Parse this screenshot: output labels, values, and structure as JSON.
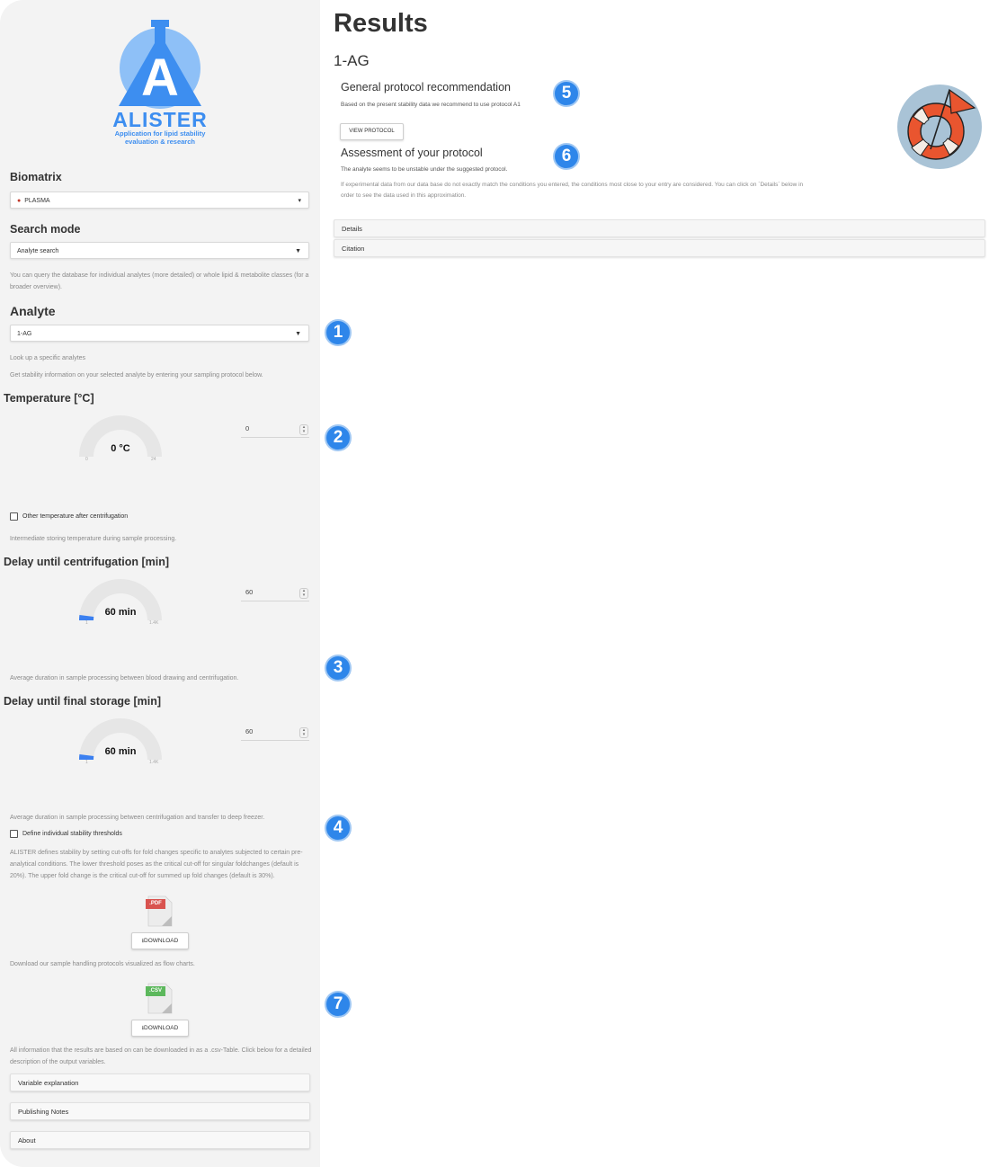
{
  "sidebar": {
    "logo": {
      "word": "ALISTER",
      "subtitle_line1": "Application for lipid stability",
      "subtitle_line2": "evaluation & research"
    },
    "biomatrix": {
      "label": "Biomatrix",
      "value": "PLASMA"
    },
    "search_mode": {
      "label": "Search mode",
      "value": "Analyte search",
      "help": "You can query the database for individual analytes (more detailed) or whole lipid & metabolite classes (for a broader overview)."
    },
    "analyte": {
      "label": "Analyte",
      "value": "1-AG",
      "help1": "Look up a specific analytes",
      "help2": "Get stability information on your selected analyte by entering your sampling protocol below."
    },
    "temperature": {
      "label": "Temperature [°C]",
      "gauge_value": "0 °C",
      "gauge_min": "0",
      "gauge_max": "24",
      "gauge_fraction": 0,
      "input_value": "0",
      "checkbox_label": "Other temperature after centrifugation",
      "help": "Intermediate storing temperature during sample processing."
    },
    "delay_centrifugation": {
      "label": "Delay until centrifugation [min]",
      "gauge_value": "60 min",
      "gauge_min": "1",
      "gauge_max": "1.4K",
      "gauge_fraction": 0.042,
      "input_value": "60",
      "help": "Average duration in sample processing between blood drawing and centrifugation."
    },
    "delay_storage": {
      "label": "Delay until final storage [min]",
      "gauge_value": "60 min",
      "gauge_min": "1",
      "gauge_max": "1.4K",
      "gauge_fraction": 0.042,
      "input_value": "60",
      "help": "Average duration in sample processing between centrifugation and transfer to deep freezer."
    },
    "thresholds": {
      "checkbox_label": "Define individual stability thresholds",
      "help": "ALISTER defines stability by setting cut-offs for fold changes specific to analytes subjected to certain pre-analytical conditions. The lower threshold poses as the critical cut-off for singular foldchanges (default is 20%). The upper fold change is the critical cut-off for summed up fold changes (default is 30%)."
    },
    "pdf": {
      "badge": ".PDF",
      "button": "DOWNLOAD",
      "help": "Download our sample handling protocols visualized as flow charts."
    },
    "csv": {
      "badge": ".CSV",
      "button": "DOWNLOAD",
      "help": "All information that the results are based on can be downloaded in as a .csv-Table. Click below for a detailed description of the output variables."
    },
    "collapsibles": [
      "Variable explanation",
      "Publishing Notes",
      "About"
    ]
  },
  "main": {
    "title": "Results",
    "analyte": "1-AG",
    "recommendation": {
      "heading": "General protocol recommendation",
      "text": "Based on the present stability data we recommend to use protocol A1",
      "button": "VIEW PROTOCOL"
    },
    "assessment": {
      "heading": "Assessment of your protocol",
      "text": "The analyte seems to be unstable under the suggested protocol.",
      "note": "If experimental data from our data base do not exactly match the conditions you entered, the conditions most close to your entry are considered. You can click on `Details` below in order to see the data used in this approximation."
    },
    "panels": [
      "Details",
      "Citation"
    ]
  },
  "badges": [
    "1",
    "2",
    "3",
    "4",
    "5",
    "6",
    "7"
  ],
  "colors": {
    "accent": "#2e86ea",
    "gauge_fill": "#3a7ff0",
    "gauge_track": "#e6e6e6",
    "pdf": "#d9534f",
    "csv": "#5cb85c"
  }
}
